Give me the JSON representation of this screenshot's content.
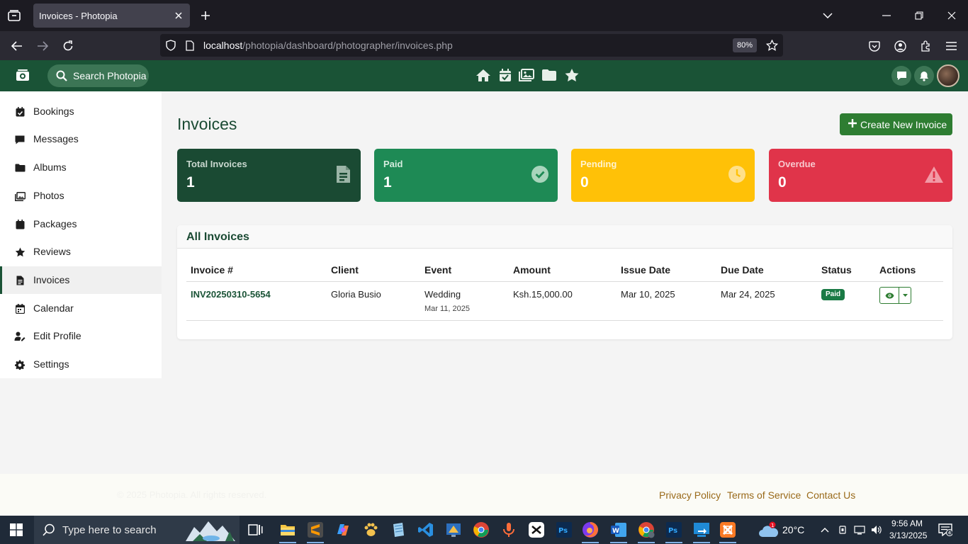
{
  "browser": {
    "tab_title": "Invoices - Photopia",
    "url_host": "localhost",
    "url_path": "/photopia/dashboard/photographer/invoices.php",
    "zoom": "80%"
  },
  "app": {
    "search_placeholder": "Search Photopia",
    "brand_color": "#1a5336",
    "header_icons": [
      "home-icon",
      "calendar-check-icon",
      "images-icon",
      "folder-icon",
      "star-icon"
    ],
    "right_icons": [
      "comment-icon",
      "bell-icon",
      "avatar"
    ]
  },
  "sidebar": {
    "items": [
      {
        "label": "Bookings",
        "icon": "calendar-check-icon"
      },
      {
        "label": "Messages",
        "icon": "comment-icon"
      },
      {
        "label": "Albums",
        "icon": "folder-icon"
      },
      {
        "label": "Photos",
        "icon": "images-icon"
      },
      {
        "label": "Packages",
        "icon": "box-icon"
      },
      {
        "label": "Reviews",
        "icon": "star-icon"
      },
      {
        "label": "Invoices",
        "icon": "file-invoice-icon",
        "active": true
      },
      {
        "label": "Calendar",
        "icon": "calendar-icon"
      },
      {
        "label": "Edit Profile",
        "icon": "user-edit-icon"
      },
      {
        "label": "Settings",
        "icon": "gear-icon"
      }
    ]
  },
  "main": {
    "title": "Invoices",
    "create_button": "Create New Invoice",
    "stats": [
      {
        "title": "Total Invoices",
        "value": "1",
        "icon": "file-invoice-icon",
        "color": "#1a4a33"
      },
      {
        "title": "Paid",
        "value": "1",
        "icon": "check-circle-icon",
        "color": "#1e8a55"
      },
      {
        "title": "Pending",
        "value": "0",
        "icon": "clock-icon",
        "color": "#ffc107"
      },
      {
        "title": "Overdue",
        "value": "0",
        "icon": "warning-icon",
        "color": "#e0344a"
      }
    ],
    "table": {
      "title": "All Invoices",
      "columns": [
        "Invoice #",
        "Client",
        "Event",
        "Amount",
        "Issue Date",
        "Due Date",
        "Status",
        "Actions"
      ],
      "rows": [
        {
          "invoice": "INV20250310-5654",
          "client": "Gloria Busio",
          "event": "Wedding",
          "event_date": "Mar 11, 2025",
          "amount": "Ksh.15,000.00",
          "issue_date": "Mar 10, 2025",
          "due_date": "Mar 24, 2025",
          "status": "Paid"
        }
      ]
    }
  },
  "footer": {
    "copyright": "© 2025 Photopia. All rights reserved.",
    "links": [
      "Privacy Policy",
      "Terms of Service",
      "Contact Us"
    ]
  },
  "taskbar": {
    "search_placeholder": "Type here to search",
    "temperature": "20°C",
    "weather_badge": "1",
    "time": "9:56 AM",
    "date": "3/13/2025",
    "notification_count": "4"
  }
}
